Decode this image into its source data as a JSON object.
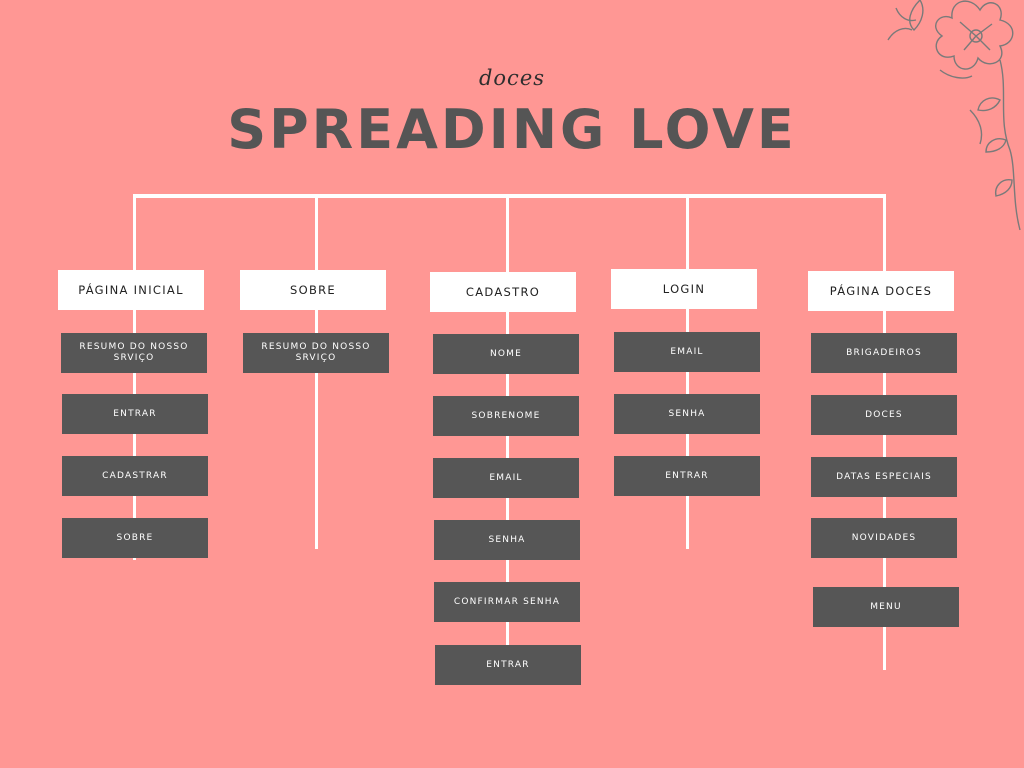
{
  "header": {
    "subtitle": "doces",
    "title": "SPREADING LOVE"
  },
  "decoration": {
    "icon": "floral-sketch-icon",
    "color": "#7a7a7a"
  },
  "colors": {
    "background": "#FF9794",
    "box_dark": "#565656",
    "box_light": "#ffffff",
    "text_dark": "#555555"
  },
  "columns": [
    {
      "heading": "Página Inicial",
      "items": [
        "Resumo do nosso srviço",
        "Entrar",
        "Cadastrar",
        "Sobre"
      ]
    },
    {
      "heading": "Sobre",
      "items": [
        "Resumo do nosso srviço"
      ]
    },
    {
      "heading": "Cadastro",
      "items": [
        "Nome",
        "Sobrenome",
        "Email",
        "Senha",
        "Confirmar Senha",
        "Entrar"
      ]
    },
    {
      "heading": "Login",
      "items": [
        "Email",
        "Senha",
        "Entrar"
      ]
    },
    {
      "heading": "Página Doces",
      "items": [
        "Brigadeiros",
        "Doces",
        "Datas Especiais",
        "Novidades",
        "Menu"
      ]
    }
  ]
}
